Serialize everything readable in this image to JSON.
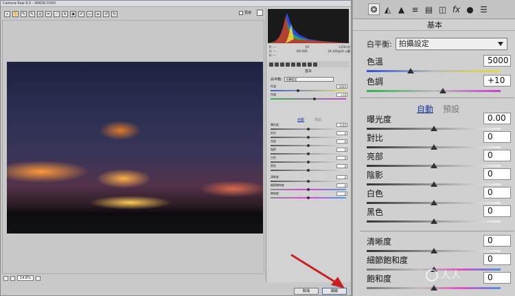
{
  "small_window": {
    "title": "Camera Raw 6.0 - NIKON D300",
    "preview_label": "預視",
    "zoom": "14.6%",
    "cancel_label": "取消",
    "ok_label": "開啟",
    "meta": {
      "r": "R: ---",
      "g": "G: ---",
      "b": "B: ---",
      "aperture": "f/5",
      "shutter": "1/250 秒",
      "iso": "ISO 400",
      "lens": "24-105@24 公釐"
    },
    "section_title": "基本",
    "white_balance_label": "白平衡:",
    "white_balance_value": "拍攝設定",
    "auto_label": "自動",
    "default_label": "預設",
    "sliders": [
      {
        "label": "色溫",
        "value": "5000"
      },
      {
        "label": "色調",
        "value": "+10"
      },
      {
        "label": "曝光度",
        "value": "0.00"
      },
      {
        "label": "對比",
        "value": "0"
      },
      {
        "label": "亮部",
        "value": "0"
      },
      {
        "label": "陰影",
        "value": "0"
      },
      {
        "label": "白色",
        "value": "0"
      },
      {
        "label": "黑色",
        "value": "0"
      },
      {
        "label": "清晰度",
        "value": "0"
      },
      {
        "label": "細節飽和度",
        "value": "0"
      },
      {
        "label": "飽和度",
        "value": "0"
      }
    ]
  },
  "big_panel": {
    "section_title": "基本",
    "white_balance_label": "白平衡:",
    "white_balance_value": "拍攝設定",
    "temp": {
      "label": "色溫",
      "value": "5000",
      "level": 0.33
    },
    "tint": {
      "label": "色調",
      "value": "+10",
      "level": 0.57
    },
    "auto_label": "自動",
    "default_label": "預設",
    "tone": [
      {
        "label": "曝光度",
        "value": "0.00",
        "level": 0.5
      },
      {
        "label": "對比",
        "value": "0",
        "level": 0.5
      },
      {
        "label": "亮部",
        "value": "0",
        "level": 0.5
      },
      {
        "label": "陰影",
        "value": "0",
        "level": 0.5
      },
      {
        "label": "白色",
        "value": "0",
        "level": 0.5
      },
      {
        "label": "黑色",
        "value": "0",
        "level": 0.5
      }
    ],
    "presence": [
      {
        "label": "清晰度",
        "value": "0",
        "level": 0.5
      },
      {
        "label": "細節飽和度",
        "value": "0",
        "level": 0.5
      },
      {
        "label": "飽和度",
        "value": "0",
        "level": 0.5
      }
    ],
    "tab_icons": [
      "aperture-icon",
      "tone-curve-icon",
      "detail-icon",
      "hsl-icon",
      "split-toning-icon",
      "lens-icon",
      "fx-icon",
      "camera-calibration-icon",
      "presets-icon"
    ]
  },
  "watermark": "人人"
}
